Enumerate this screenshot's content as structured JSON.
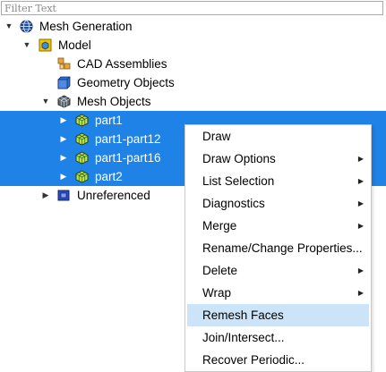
{
  "filter": {
    "placeholder": "Filter Text"
  },
  "tree": {
    "root": {
      "label": "Mesh Generation",
      "icon": "globe-icon"
    },
    "model": {
      "label": "Model",
      "icon": "model-icon"
    },
    "cad_assemblies": {
      "label": "CAD Assemblies",
      "icon": "cad-assemblies-icon"
    },
    "geometry_objects": {
      "label": "Geometry Objects",
      "icon": "geometry-cube-icon"
    },
    "mesh_objects": {
      "label": "Mesh Objects",
      "icon": "mesh-cube-icon"
    },
    "parts": [
      {
        "label": "part1",
        "icon": "mesh-part-icon",
        "selected": true
      },
      {
        "label": "part1-part12",
        "icon": "mesh-part-icon",
        "selected": true
      },
      {
        "label": "part1-part16",
        "icon": "mesh-part-icon",
        "selected": true
      },
      {
        "label": "part2",
        "icon": "mesh-part-icon",
        "selected": true
      }
    ],
    "unreferenced": {
      "label": "Unreferenced",
      "icon": "unreferenced-icon"
    }
  },
  "context_menu": {
    "items": [
      {
        "label": "Draw",
        "submenu": false
      },
      {
        "label": "Draw Options",
        "submenu": true
      },
      {
        "label": "List Selection",
        "submenu": true
      },
      {
        "label": "Diagnostics",
        "submenu": true
      },
      {
        "label": "Merge",
        "submenu": true
      },
      {
        "label": "Rename/Change Properties...",
        "submenu": false
      },
      {
        "label": "Delete",
        "submenu": true
      },
      {
        "label": "Wrap",
        "submenu": true
      },
      {
        "label": "Remesh Faces",
        "submenu": false,
        "highlighted": true
      },
      {
        "label": "Join/Intersect...",
        "submenu": false
      },
      {
        "label": "Recover Periodic...",
        "submenu": false
      }
    ]
  },
  "colors": {
    "selection": "#1e82e6",
    "menu_highlight": "#cce4f7"
  }
}
